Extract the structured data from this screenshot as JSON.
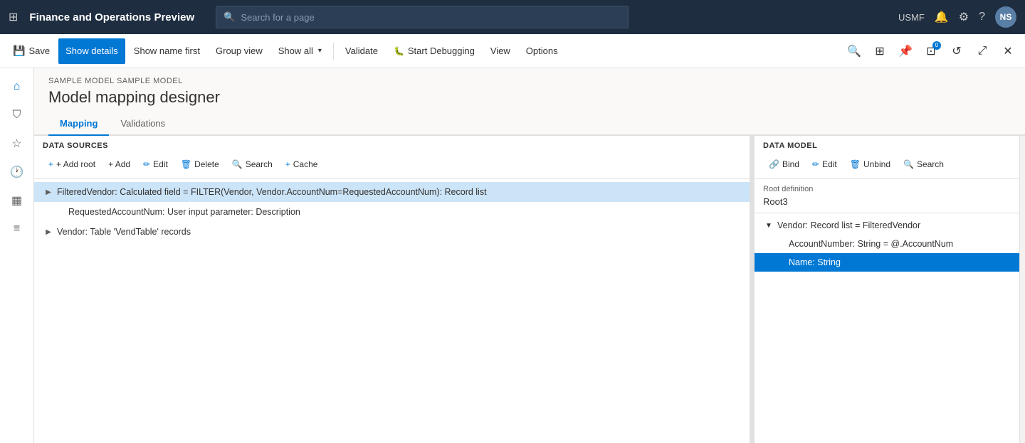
{
  "topNav": {
    "title": "Finance and Operations Preview",
    "searchPlaceholder": "Search for a page",
    "userInitials": "NS",
    "userLabel": "USMF"
  },
  "toolbar": {
    "saveLabel": "Save",
    "showDetailsLabel": "Show details",
    "showNameFirstLabel": "Show name first",
    "groupViewLabel": "Group view",
    "showAllLabel": "Show all",
    "validateLabel": "Validate",
    "startDebuggingLabel": "Start Debugging",
    "viewLabel": "View",
    "optionsLabel": "Options"
  },
  "page": {
    "breadcrumb": "SAMPLE MODEL SAMPLE MODEL",
    "title": "Model mapping designer"
  },
  "tabs": [
    {
      "id": "mapping",
      "label": "Mapping",
      "active": true
    },
    {
      "id": "validations",
      "label": "Validations",
      "active": false
    }
  ],
  "dataSources": {
    "sectionTitle": "DATA SOURCES",
    "buttons": {
      "addRoot": "+ Add root",
      "add": "+ Add",
      "edit": "Edit",
      "delete": "Delete",
      "search": "Search",
      "cache": "Cache"
    },
    "items": [
      {
        "id": "filteredVendor",
        "label": "FilteredVendor: Calculated field = FILTER(Vendor, Vendor.AccountNum=RequestedAccountNum): Record list",
        "indent": 0,
        "expanded": false,
        "selected": true,
        "hasToggle": true
      },
      {
        "id": "requestedAccountNum",
        "label": "RequestedAccountNum: User input parameter: Description",
        "indent": 1,
        "expanded": false,
        "selected": false,
        "hasToggle": false
      },
      {
        "id": "vendor",
        "label": "Vendor: Table 'VendTable' records",
        "indent": 0,
        "expanded": false,
        "selected": false,
        "hasToggle": true
      }
    ]
  },
  "dataModel": {
    "sectionTitle": "DATA MODEL",
    "buttons": {
      "bind": "Bind",
      "edit": "Edit",
      "unbind": "Unbind",
      "search": "Search"
    },
    "rootDefinitionLabel": "Root definition",
    "rootDefinitionValue": "Root3",
    "items": [
      {
        "id": "vendorRecordList",
        "label": "Vendor: Record list = FilteredVendor",
        "indent": 0,
        "expanded": true,
        "selected": false,
        "hasToggle": true,
        "toggleDir": "down"
      },
      {
        "id": "accountNumber",
        "label": "AccountNumber: String = @.AccountNum",
        "indent": 1,
        "expanded": false,
        "selected": false,
        "hasToggle": false
      },
      {
        "id": "nameString",
        "label": "Name: String",
        "indent": 1,
        "expanded": false,
        "selected": true,
        "hasToggle": false
      }
    ]
  },
  "icons": {
    "grid": "⊞",
    "search": "🔍",
    "save": "💾",
    "filter": "⛉",
    "star": "☆",
    "clock": "🕐",
    "table": "▦",
    "list": "≡",
    "home": "⌂",
    "bell": "🔔",
    "gear": "⚙",
    "question": "?",
    "link": "🔗",
    "pencil": "✏",
    "trash": "🗑",
    "plus": "+",
    "chevronRight": "▶",
    "chevronDown": "▼",
    "chevronSmallDown": "▾",
    "close": "✕",
    "refresh": "↺",
    "expand": "⤢",
    "connect": "⊞",
    "pin": "📌",
    "debug": "🐛"
  }
}
